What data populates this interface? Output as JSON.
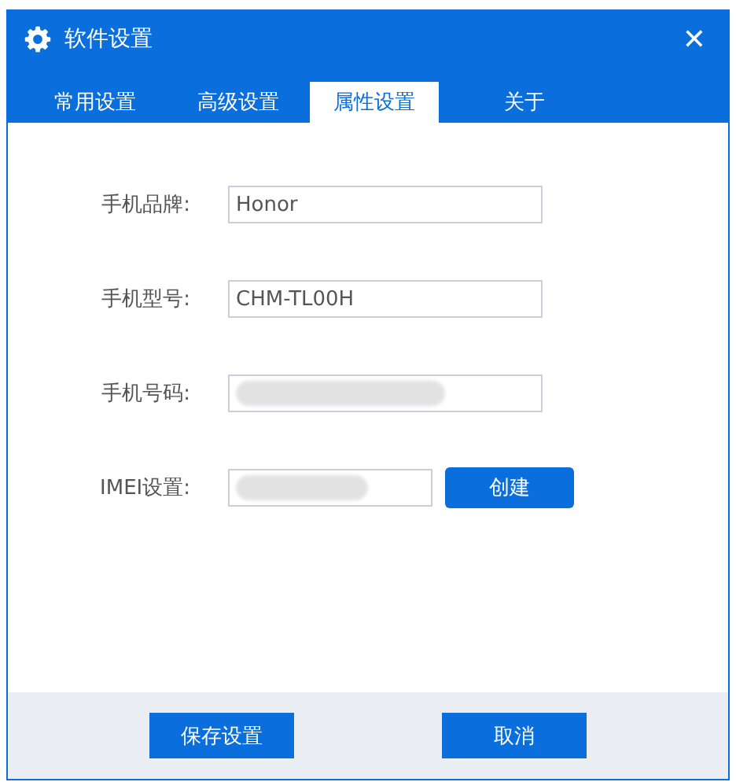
{
  "window": {
    "title": "软件设置",
    "close": "✕"
  },
  "tabs": [
    {
      "label": "常用设置",
      "selected": false
    },
    {
      "label": "高级设置",
      "selected": false
    },
    {
      "label": "属性设置",
      "selected": true
    },
    {
      "label": "关于",
      "selected": false
    }
  ],
  "fields": [
    {
      "label": "手机品牌:",
      "value": "Honor",
      "redacted": false
    },
    {
      "label": "手机型号:",
      "value": "CHM-TL00H",
      "redacted": false
    },
    {
      "label": "手机号码:",
      "redacted": true
    },
    {
      "label": "IMEI设置:",
      "redacted": true,
      "button": "创建"
    }
  ],
  "buttons": [
    "保存设置",
    "取消"
  ]
}
